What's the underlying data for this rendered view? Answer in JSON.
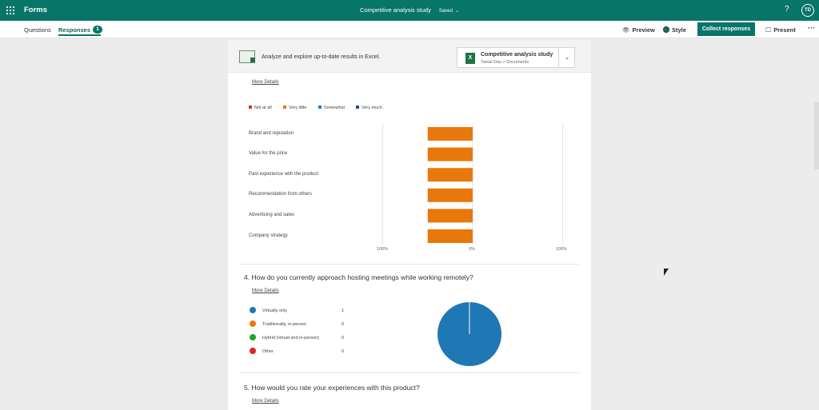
{
  "app": {
    "name": "Forms",
    "title": "Competitive analysis study",
    "status": "Saved"
  },
  "user": {
    "initials": "TD"
  },
  "tabs": {
    "questions": "Questions",
    "responses": "Responses",
    "responses_count": "1"
  },
  "toolbar": {
    "preview": "Preview",
    "style": "Style",
    "collect": "Collect responses",
    "present": "Present",
    "help": "?",
    "more": "···"
  },
  "excel": {
    "prompt": "Analyze and explore up-to-date results in Excel.",
    "file_name": "Competitive analysis study",
    "file_path": "Tamal Das > Documents"
  },
  "links": {
    "more_details": "More Details"
  },
  "q3": {
    "legend": [
      {
        "label": "Not at all",
        "color": "#c43e1c"
      },
      {
        "label": "Very little",
        "color": "#e8780b"
      },
      {
        "label": "Somewhat",
        "color": "#1f7fc4"
      },
      {
        "label": "Very much",
        "color": "#1f4a8c"
      }
    ],
    "axis_labels": [
      "100%",
      "0%",
      "100%"
    ]
  },
  "q4": {
    "title": "4. How do you currently approach hosting meetings while working remotely?",
    "options": [
      {
        "label": "Virtually only",
        "count": "1",
        "color": "#1f77b4"
      },
      {
        "label": "Traditionally, in-person",
        "count": "0",
        "color": "#e8780b"
      },
      {
        "label": "Hybrid (virtual and in-person)",
        "count": "0",
        "color": "#2ca02c"
      },
      {
        "label": "Other",
        "count": "0",
        "color": "#d62728"
      }
    ]
  },
  "q5": {
    "title": "5. How would you rate your experiences with this product?"
  },
  "chart_data": [
    {
      "type": "bar",
      "categories": [
        "Brand and reputation",
        "Value for the price",
        "Past experience with the product",
        "Recommendation from others",
        "Advertising and sales",
        "Company strategy"
      ],
      "series": [
        {
          "name": "Not at all",
          "values": [
            0,
            0,
            0,
            0,
            0,
            0
          ]
        },
        {
          "name": "Very little",
          "values": [
            100,
            100,
            100,
            100,
            100,
            100
          ]
        },
        {
          "name": "Somewhat",
          "values": [
            0,
            0,
            0,
            0,
            0,
            0
          ]
        },
        {
          "name": "Very much",
          "values": [
            0,
            0,
            0,
            0,
            0,
            0
          ]
        }
      ],
      "xlim": [
        -100,
        100
      ],
      "xlabel": "",
      "ylabel": "",
      "grid": true,
      "legend": "top-left"
    },
    {
      "type": "pie",
      "categories": [
        "Virtually only",
        "Traditionally, in-person",
        "Hybrid (virtual and in-person)",
        "Other"
      ],
      "values": [
        1,
        0,
        0,
        0
      ]
    }
  ]
}
